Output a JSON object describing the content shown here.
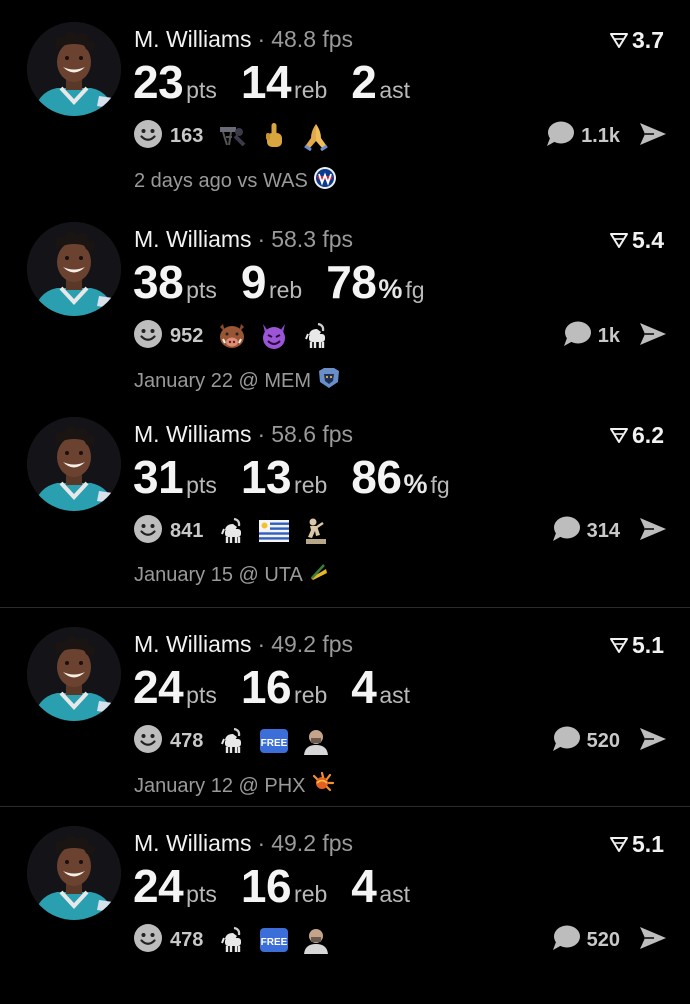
{
  "posts": [
    {
      "player": "M. Williams",
      "sep": "·",
      "fps": "48.8 fps",
      "score": "3.7",
      "stats": [
        {
          "value": "23",
          "unit": "pts"
        },
        {
          "value": "14",
          "unit": "reb"
        },
        {
          "value": "2",
          "unit": "ast"
        }
      ],
      "reaction_count": "163",
      "emojis": [
        "dunk-icon",
        "middle-finger-icon",
        "praying-hands-icon"
      ],
      "comment_count": "1.1k",
      "meta": "2 days ago vs WAS",
      "team_logo": "wizards-logo-icon"
    },
    {
      "player": "M. Williams",
      "sep": "·",
      "fps": "58.3 fps",
      "score": "5.4",
      "stats": [
        {
          "value": "38",
          "unit": "pts"
        },
        {
          "value": "9",
          "unit": "reb"
        },
        {
          "value": "78",
          "pct": "%",
          "unit": "fg"
        }
      ],
      "reaction_count": "952",
      "emojis": [
        "boar-icon",
        "devil-icon",
        "goat-icon"
      ],
      "comment_count": "1k",
      "meta": "January 22 @ MEM",
      "team_logo": "grizzlies-logo-icon"
    },
    {
      "player": "M. Williams",
      "sep": "·",
      "fps": "58.6 fps",
      "score": "6.2",
      "stats": [
        {
          "value": "31",
          "unit": "pts"
        },
        {
          "value": "13",
          "unit": "reb"
        },
        {
          "value": "86",
          "pct": "%",
          "unit": "fg"
        }
      ],
      "reaction_count": "841",
      "emojis": [
        "goat-icon",
        "uruguay-flag-icon",
        "statue-icon"
      ],
      "comment_count": "314",
      "meta": "January 15 @ UTA",
      "team_logo": "jazz-logo-icon"
    },
    {
      "player": "M. Williams",
      "sep": "·",
      "fps": "49.2 fps",
      "score": "5.1",
      "stats": [
        {
          "value": "24",
          "unit": "pts"
        },
        {
          "value": "16",
          "unit": "reb"
        },
        {
          "value": "4",
          "unit": "ast"
        }
      ],
      "reaction_count": "478",
      "emojis": [
        "goat-icon",
        "free-button-icon",
        "bald-man-icon"
      ],
      "comment_count": "520",
      "meta": "January 12 @ PHX",
      "team_logo": "suns-logo-icon"
    },
    {
      "player": "M. Williams",
      "sep": "·",
      "fps": "49.2 fps",
      "score": "5.1",
      "stats": [
        {
          "value": "24",
          "unit": "pts"
        },
        {
          "value": "16",
          "unit": "reb"
        },
        {
          "value": "4",
          "unit": "ast"
        }
      ],
      "reaction_count": "478",
      "emojis": [
        "goat-icon",
        "free-button-icon",
        "bald-man-icon"
      ],
      "comment_count": "520",
      "meta": "",
      "team_logo": ""
    }
  ],
  "emoji_labels": {
    "free": "FREE"
  },
  "colors": {
    "background": "#000000",
    "muted": "#9a9a9a",
    "jersey_teal": "#2a9fb0"
  }
}
